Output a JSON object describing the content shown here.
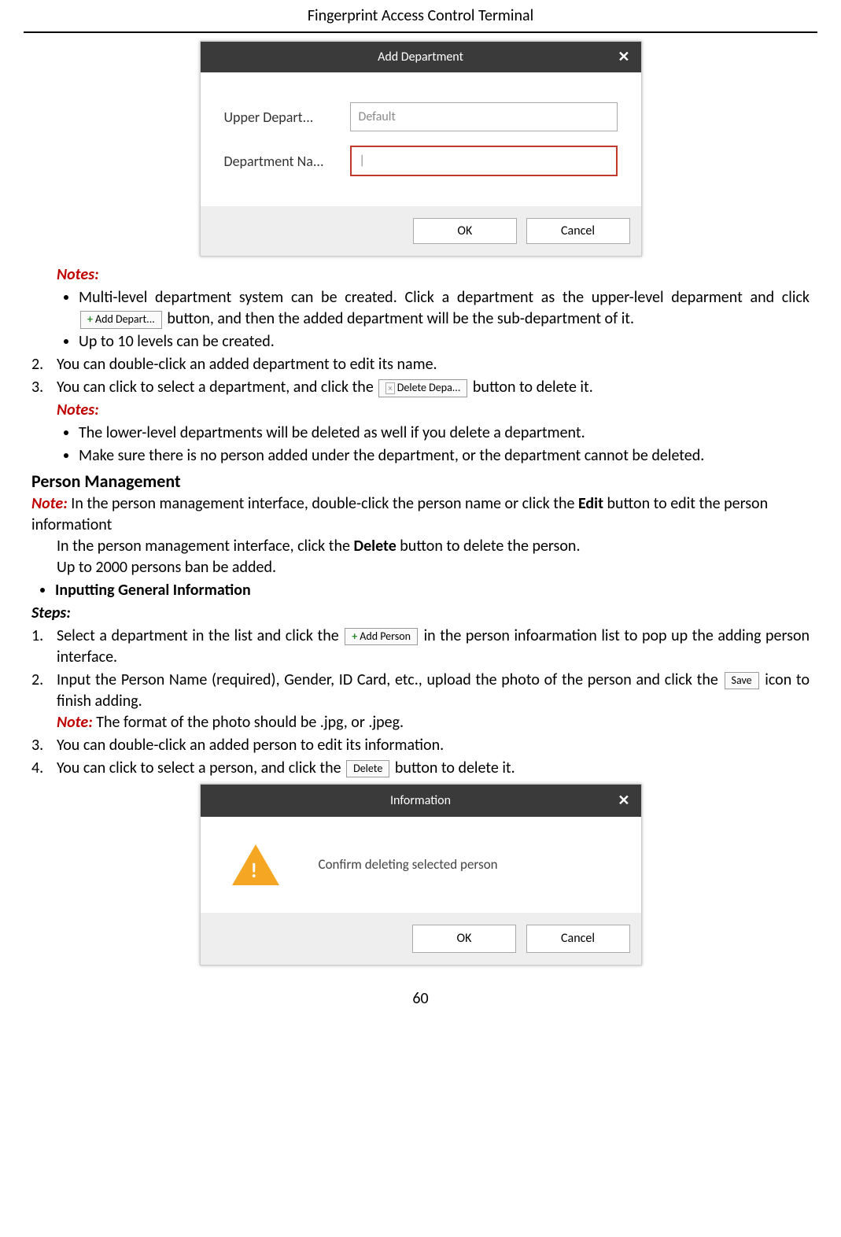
{
  "header": "Fingerprint Access Control Terminal",
  "addDeptDialog": {
    "title": "Add Department",
    "field1Label": "Upper Depart...",
    "field1Value": "Default",
    "field2Label": "Department Na...",
    "field2Value": "|",
    "ok": "OK",
    "cancel": "Cancel"
  },
  "notesLabel": "Notes:",
  "note1a": "Multi-level department system can be created. Click a department as the upper-level deparment and click ",
  "btnAddDepart": "Add Depart...",
  "note1b": " button, and then the added department will be the sub-department of it.",
  "note2": "Up to 10 levels can be created.",
  "step2": "You can double-click an added department to edit its name.",
  "step3a": "You can click to select a department, and click the ",
  "btnDeleteDepa": "Delete Depa...",
  "step3b": " button to delete it.",
  "note3": "The lower-level departments will be deleted as well if you delete a department.",
  "note4": "Make sure there is no person added under the department, or the department cannot be deleted.",
  "personMgmt": "Person Management",
  "noteLabel": "Note:",
  "pm1a": " In the person management interface, double-click the person name or click the ",
  "pm1b": "Edit",
  "pm1c": " button to edit the person informationt",
  "pm2a": "In the person management interface, click the ",
  "pm2b": "Delete",
  "pm2c": " button to delete the person.",
  "pm3": "Up to 2000 persons ban be added.",
  "inputGen": "Inputting General Information",
  "stepsLabel": "Steps:",
  "s1a": "Select a department in the list and click the ",
  "btnAddPerson": "Add Person",
  "s1b": " in the person infoarmation list to pop up the adding person interface.",
  "s2a": "Input the Person Name (required), Gender, ID Card, etc., upload the photo of the person and click the ",
  "btnSave": "Save",
  "s2b": " icon to finish adding.",
  "s2note": " The format of the photo should be .jpg, or .jpeg.",
  "s3": "You can double-click an added person to edit its information.",
  "s4a": "You can click to select a person, and click the ",
  "btnDelete": "Delete",
  "s4b": " button to delete it.",
  "infoDialog": {
    "title": "Information",
    "msg": "Confirm deleting selected person",
    "ok": "OK",
    "cancel": "Cancel"
  },
  "pageNum": "60"
}
